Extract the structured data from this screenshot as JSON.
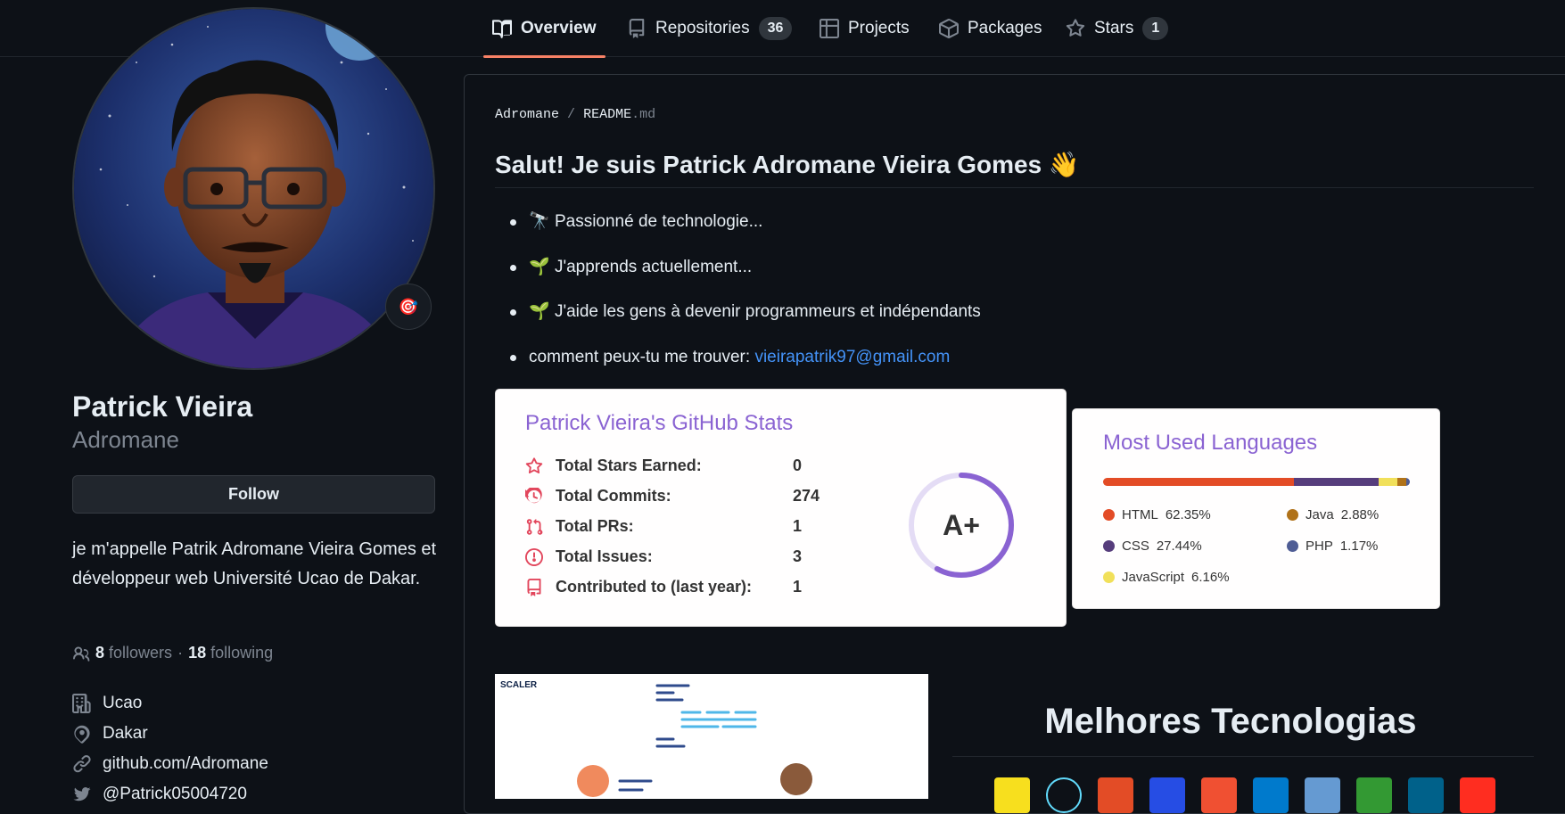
{
  "tabs": [
    {
      "label": "Overview",
      "icon": "book-icon",
      "active": true
    },
    {
      "label": "Repositories",
      "icon": "repo-icon",
      "count": "36"
    },
    {
      "label": "Projects",
      "icon": "table-icon"
    },
    {
      "label": "Packages",
      "icon": "package-icon"
    },
    {
      "label": "Stars",
      "icon": "star-icon",
      "count": "1"
    }
  ],
  "profile": {
    "name": "Patrick Vieira",
    "login": "Adromane",
    "follow_label": "Follow",
    "status_emoji": "🎯",
    "bio": "je m'appelle Patrik Adromane Vieira Gomes et développeur web Université Ucao de Dakar.",
    "followers_count": "8",
    "followers_label": "followers",
    "separator": "·",
    "following_count": "18",
    "following_label": "following",
    "organization": "Ucao",
    "location": "Dakar",
    "website": "github.com/Adromane",
    "twitter": "@Patrick05004720"
  },
  "readme": {
    "owner": "Adromane",
    "sep": "/",
    "file": "README",
    "ext": ".md",
    "heading": "Salut! Je suis Patrick Adromane Vieira Gomes 👋",
    "items": [
      {
        "emoji": "🔭",
        "text": "Passionné de technologie..."
      },
      {
        "emoji": "🌱",
        "text": "J'apprends actuellement..."
      },
      {
        "emoji": "🌱",
        "text": "J'aide les gens à devenir programmeurs et indépendants"
      },
      {
        "text": "comment peux-tu me trouver: ",
        "link": "vieirapatrik97@gmail.com"
      }
    ]
  },
  "stats_card": {
    "title": "Patrick Vieira's GitHub Stats",
    "rows": [
      {
        "label": "Total Stars Earned:",
        "value": "0",
        "icon": "star-outline-icon"
      },
      {
        "label": "Total Commits:",
        "value": "274",
        "icon": "history-icon"
      },
      {
        "label": "Total PRs:",
        "value": "1",
        "icon": "pull-request-icon"
      },
      {
        "label": "Total Issues:",
        "value": "3",
        "icon": "issue-icon"
      },
      {
        "label": "Contributed to (last year):",
        "value": "1",
        "icon": "repo-icon"
      }
    ],
    "grade": "A+",
    "ring_fraction": 0.58,
    "accent": "#8a63d2"
  },
  "languages_card": {
    "title": "Most Used Languages",
    "langs": [
      {
        "name": "HTML",
        "percent": "62.35%",
        "value": 62.35,
        "color": "#e34c26"
      },
      {
        "name": "CSS",
        "percent": "27.44%",
        "value": 27.44,
        "color": "#563d7c"
      },
      {
        "name": "JavaScript",
        "percent": "6.16%",
        "value": 6.16,
        "color": "#f1e05a"
      },
      {
        "name": "Java",
        "percent": "2.88%",
        "value": 2.88,
        "color": "#b07219"
      },
      {
        "name": "PHP",
        "percent": "1.17%",
        "value": 1.17,
        "color": "#4f5d95"
      }
    ]
  },
  "illustration": {
    "brand": "SCALER"
  },
  "tech_section": {
    "title": "Melhores Tecnologias",
    "icons": [
      {
        "name": "javascript-icon",
        "color": "#f7df1e"
      },
      {
        "name": "react-icon",
        "color": "#0d1117"
      },
      {
        "name": "html5-icon",
        "color": "#e34c26"
      },
      {
        "name": "css3-icon",
        "color": "#264de4"
      },
      {
        "name": "git-icon",
        "color": "#f05032"
      },
      {
        "name": "vscode-icon",
        "color": "#007acc"
      },
      {
        "name": "c-icon",
        "color": "#659ad2"
      },
      {
        "name": "nodejs-icon",
        "color": "#339933"
      },
      {
        "name": "mysql-icon",
        "color": "#00618a"
      },
      {
        "name": "laravel-icon",
        "color": "#ff2d20"
      }
    ]
  }
}
